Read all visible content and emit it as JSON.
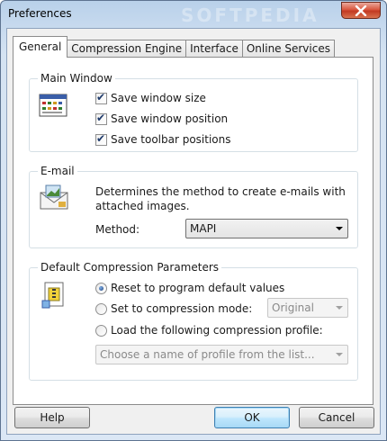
{
  "window": {
    "title": "Preferences",
    "watermark": "SOFTPEDIA"
  },
  "tabs": [
    {
      "label": "General",
      "active": true
    },
    {
      "label": "Compression Engine",
      "active": false
    },
    {
      "label": "Interface",
      "active": false
    },
    {
      "label": "Online Services",
      "active": false
    }
  ],
  "main_window": {
    "title": "Main Window",
    "options": [
      {
        "label": "Save window size",
        "checked": true
      },
      {
        "label": "Save window position",
        "checked": true
      },
      {
        "label": "Save toolbar positions",
        "checked": true
      }
    ]
  },
  "email": {
    "title": "E-mail",
    "description": "Determines the method to create e-mails with attached images.",
    "method_label": "Method:",
    "method_value": "MAPI"
  },
  "compression": {
    "title": "Default Compression Parameters",
    "options": [
      {
        "label": "Reset to program default values",
        "selected": true
      },
      {
        "label": "Set to compression mode:",
        "selected": false
      },
      {
        "label": "Load the following compression profile:",
        "selected": false
      }
    ],
    "mode_value": "Original",
    "profile_placeholder": "Choose a name of profile from the list..."
  },
  "buttons": {
    "help": "Help",
    "ok": "OK",
    "cancel": "Cancel"
  },
  "icons": {
    "close": "close-icon",
    "window": "window-layout-icon",
    "email": "envelope-icon",
    "compression": "compression-archive-icon"
  }
}
